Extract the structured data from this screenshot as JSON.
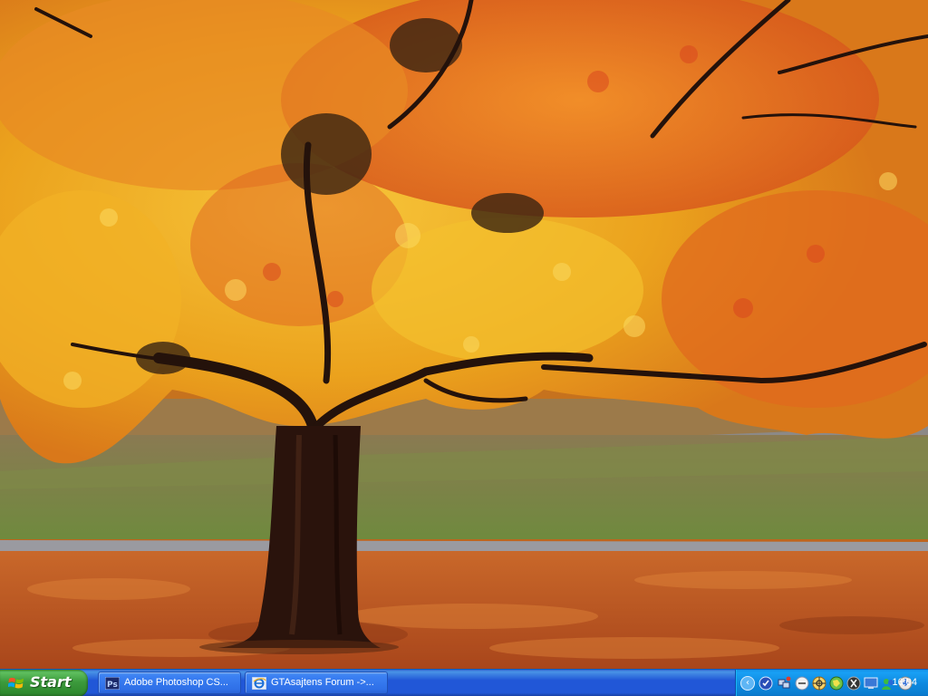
{
  "desktop": {
    "wallpaper": "autumn-tree",
    "colors": {
      "foliage_yellow": "#e8a317",
      "foliage_orange": "#e0661c",
      "leaf_litter": "#c65a1e",
      "grass": "#6b8a3c",
      "trunk": "#2a130c",
      "path": "#8c8c94"
    }
  },
  "taskbar": {
    "start_label": "Start",
    "buttons": [
      {
        "label": "Adobe Photoshop CS...",
        "icon": "photoshop-icon"
      },
      {
        "label": "GTAsajtens Forum ->...",
        "icon": "internet-explorer-icon"
      }
    ],
    "tray": {
      "chevron": "‹",
      "icons": [
        "security-icon",
        "network-icon",
        "volume-icon",
        "msn-icon",
        "globe-icon",
        "antivirus-icon",
        "display-icon",
        "messenger-icon",
        "update-icon"
      ],
      "clock": "16:04"
    }
  }
}
